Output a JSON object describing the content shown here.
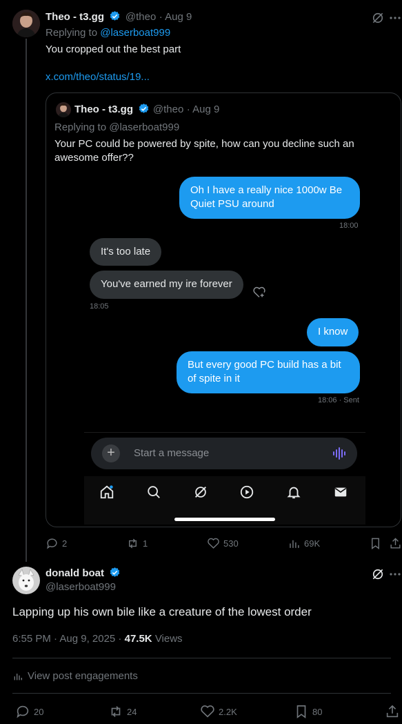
{
  "reply": {
    "author": "Theo - t3.gg",
    "handle": "@theo",
    "date": "· Aug 9",
    "replying_prefix": "Replying to",
    "replying_to": "@laserboat999",
    "text": "You cropped out the best part",
    "link": "x.com/theo/status/19...",
    "quote": {
      "author": "Theo - t3.gg",
      "handle": "@theo",
      "date": "· Aug 9",
      "replying": "Replying to @laserboat999",
      "text_line1": "Your PC could be powered by spite, how can you decline such an",
      "text_line2": "awesome offer??",
      "dm": {
        "msg1_line1": "Oh I have a really nice 1000w Be",
        "msg1_line2": "Quiet PSU around",
        "msg1_time": "18:00",
        "msg2": "It's too late",
        "msg3": "You've earned my ire forever",
        "msg3_time": "18:05",
        "msg4": "I know",
        "msg5_line1": "But every good PC build has a bit",
        "msg5_line2": "of spite in it",
        "msg5_time": "18:06 · Sent",
        "composer_placeholder": "Start a message"
      }
    },
    "stats": {
      "replies": "2",
      "reposts": "1",
      "likes": "530",
      "views": "69K"
    }
  },
  "main": {
    "author": "donald boat",
    "handle": "@laserboat999",
    "text": "Lapping up his own bile like a creature of the lowest order",
    "time": "6:55 PM · Aug 9, 2025 ·",
    "views_count": "47.5K",
    "views_label": "Views",
    "engagements": "View post engagements",
    "stats": {
      "replies": "20",
      "reposts": "24",
      "likes": "2.2K",
      "bookmarks": "80"
    }
  },
  "colors": {
    "accent": "#1d9bf0",
    "muted": "#71767b",
    "bg": "#000000"
  }
}
